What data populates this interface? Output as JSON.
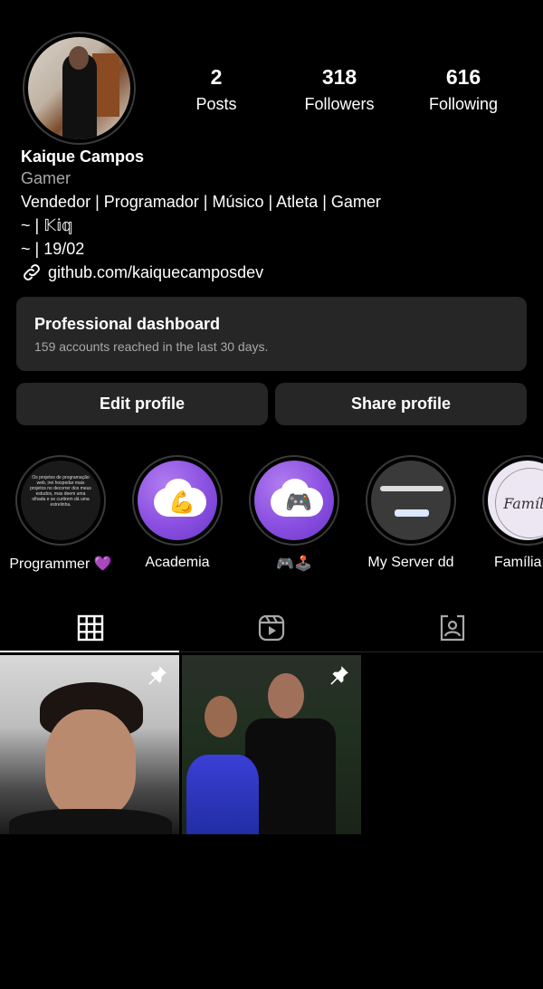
{
  "profile": {
    "name": "Kaique Campos",
    "category": "Gamer",
    "bio_lines": [
      "Vendedor | Programador | Músico | Atleta | Gamer",
      "~ | 𝕂𝕚𝕢",
      "~ | 19/02"
    ],
    "link": "github.com/kaiquecamposdev"
  },
  "stats": [
    {
      "value": "2",
      "label": "Posts"
    },
    {
      "value": "318",
      "label": "Followers"
    },
    {
      "value": "616",
      "label": "Following"
    }
  ],
  "dashboard": {
    "title": "Professional dashboard",
    "subtitle": "159 accounts reached in the last 30 days."
  },
  "buttons": {
    "edit": "Edit profile",
    "share": "Share profile"
  },
  "highlights": [
    {
      "label": "Programmer 💜"
    },
    {
      "label": "Academia",
      "icon": "💪"
    },
    {
      "label": "🎮🕹️",
      "icon": "🎮"
    },
    {
      "label": "My Server dd"
    },
    {
      "label": "Família",
      "cover_text": "Família"
    }
  ],
  "tabs": [
    {
      "name": "grid-icon"
    },
    {
      "name": "reels-icon"
    },
    {
      "name": "tagged-icon"
    }
  ],
  "colors": {
    "background": "#000000",
    "surface": "#262626",
    "secondary_text": "#a8a8a8",
    "highlight_purple": "#8a4fe0"
  }
}
